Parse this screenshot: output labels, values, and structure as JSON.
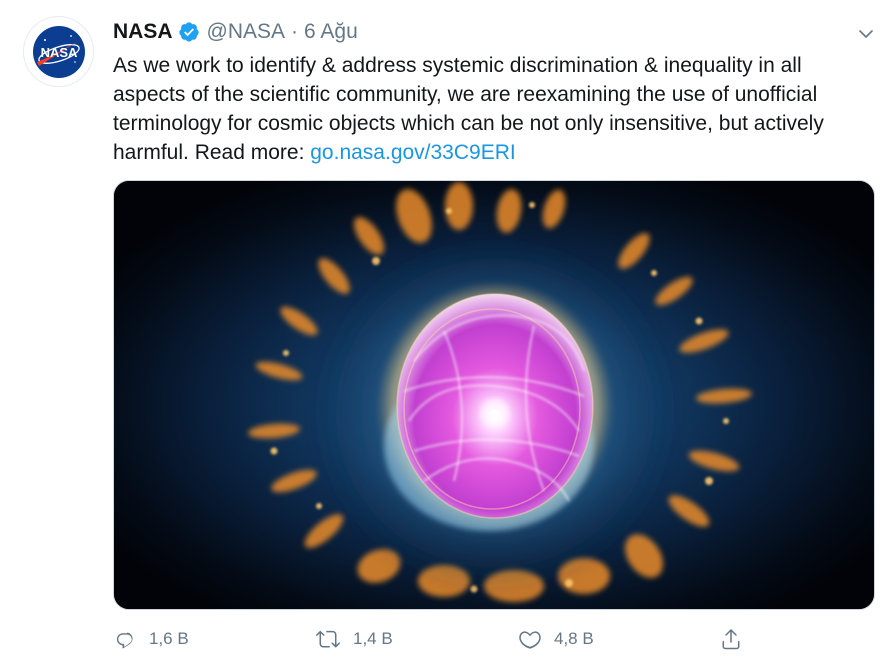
{
  "tweet": {
    "author_name": "NASA",
    "handle": "@NASA",
    "separator": "·",
    "date": "6 Ağu",
    "text_before_link": "As we work to identify & address systemic discrimination & inequality in all aspects of the scientific community, we are reexamining the use of unofficial terminology for cosmic objects which can be not only insensitive, but actively harmful. Read more: ",
    "link_text": "go.nasa.gov/33C9ERI",
    "avatar_logo_text": "NASA",
    "icons": {
      "verified": "verified-badge-icon",
      "menu": "chevron-down-icon",
      "reply": "reply-icon",
      "retweet": "retweet-icon",
      "like": "heart-icon",
      "share": "share-icon"
    },
    "colors": {
      "verified_blue": "#1da1f2",
      "link_blue": "#1b95e0",
      "muted_gray": "#657786",
      "nasa_blue": "#0b3d91",
      "nasa_red": "#fc3d21"
    }
  },
  "actions": {
    "replies": "1,6 B",
    "retweets": "1,4 B",
    "likes": "4,8 B"
  }
}
